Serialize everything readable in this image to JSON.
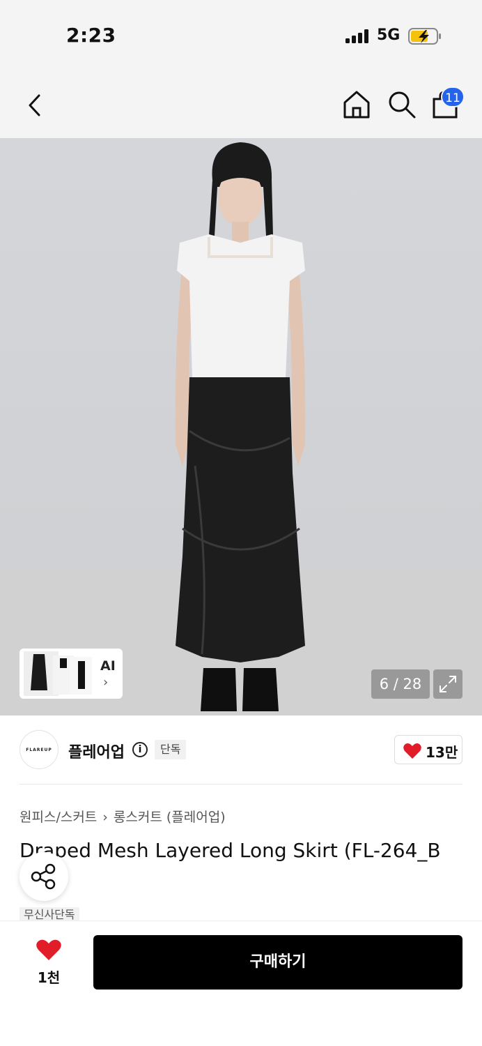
{
  "status_bar": {
    "time": "2:23",
    "network": "5G"
  },
  "header": {
    "cart_badge": "11"
  },
  "gallery": {
    "ai_label": "AI",
    "ai_arrow": "›",
    "counter": "6 / 28"
  },
  "brand": {
    "logo_text": "FLAREUP",
    "name": "플레어업",
    "info_glyph": "i",
    "tag": "단독",
    "likes": "13만"
  },
  "product": {
    "breadcrumb": [
      "원피스/스커트",
      "롱스커트 (플레어업)"
    ],
    "breadcrumb_separator": "›",
    "title": "Draped Mesh Layered Long Skirt (FL-264_B",
    "tag": "무신사단독"
  },
  "bottom_bar": {
    "wish_count": "1천",
    "buy_label": "구매하기"
  },
  "colors": {
    "accent_badge": "#2563eb",
    "heart": "#e11d2a",
    "buy_button": "#000000"
  }
}
